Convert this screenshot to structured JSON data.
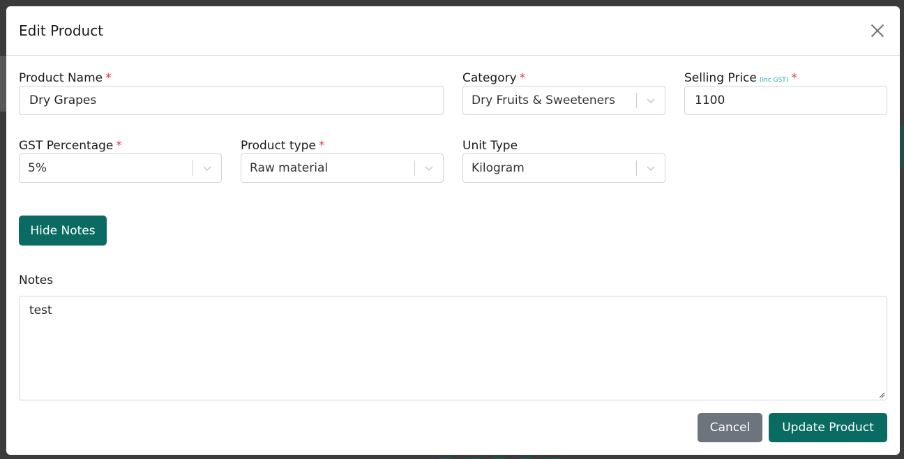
{
  "modal": {
    "title": "Edit Product"
  },
  "form": {
    "product_name": {
      "label": "Product Name",
      "required_mark": "*",
      "value": "Dry Grapes"
    },
    "category": {
      "label": "Category",
      "required_mark": "*",
      "value": "Dry Fruits & Sweeteners"
    },
    "selling_price": {
      "label": "Selling Price",
      "hint": "(Inc GST)",
      "required_mark": "*",
      "value": "1100"
    },
    "gst_percentage": {
      "label": "GST Percentage",
      "required_mark": "*",
      "value": "5%"
    },
    "product_type": {
      "label": "Product type",
      "required_mark": "*",
      "value": "Raw material"
    },
    "unit_type": {
      "label": "Unit Type",
      "value": "Kilogram"
    },
    "notes": {
      "label": "Notes",
      "value": "test"
    }
  },
  "buttons": {
    "hide_notes": "Hide Notes",
    "cancel": "Cancel",
    "update": "Update Product"
  },
  "colors": {
    "primary": "#0a6b62",
    "secondary": "#6c757d",
    "required": "#dc3545",
    "hint": "#17a2b8"
  }
}
